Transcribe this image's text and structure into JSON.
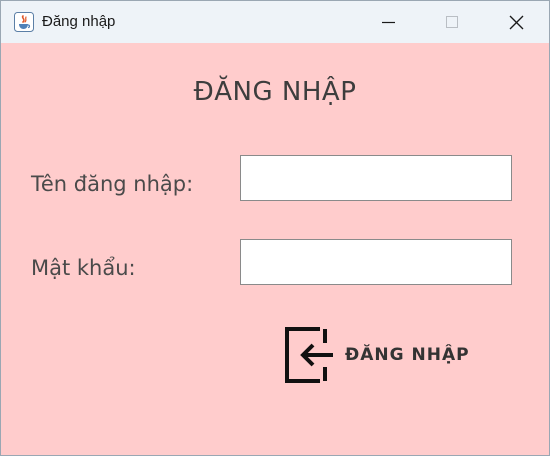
{
  "window": {
    "title": "Đăng nhập",
    "app_icon": "java-icon",
    "controls": [
      "minimize-icon",
      "maximize-icon",
      "close-icon"
    ]
  },
  "form": {
    "heading": "ĐĂNG NHẬP",
    "username_label": "Tên đăng nhập:",
    "username_value": "",
    "password_label": "Mật khẩu:",
    "password_value": "",
    "submit_label": "ĐĂNG NHẬP",
    "submit_icon": "login-arrow-icon"
  },
  "colors": {
    "background": "#ffcccc",
    "titlebar": "#eef3f8",
    "heading_text": "#3d3d3d",
    "button_text": "#333333"
  }
}
